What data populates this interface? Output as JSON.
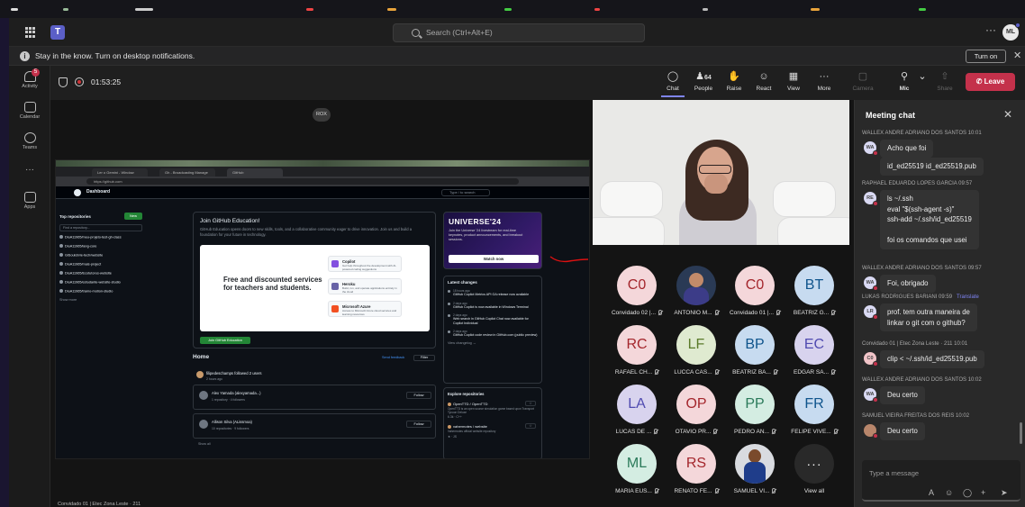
{
  "teams_header": {
    "search_placeholder": "Search (Ctrl+Alt+E)",
    "more": "···",
    "me_initials": "ML"
  },
  "notification": {
    "text": "Stay in the know. Turn on desktop notifications.",
    "turn_on": "Turn on",
    "close": "✕"
  },
  "rail": {
    "activity": {
      "label": "Activity",
      "badge": "5"
    },
    "calendar": {
      "label": "Calendar"
    },
    "teams": {
      "label": "Teams"
    },
    "more": "···",
    "apps": {
      "label": "Apps"
    }
  },
  "meeting": {
    "timer": "01:53:25",
    "toolbar": {
      "chat": "Chat",
      "people": "People",
      "people_count": "64",
      "raise": "Raise",
      "react": "React",
      "view": "View",
      "more": "More",
      "camera": "Camera",
      "mic": "Mic",
      "share": "Share",
      "leave": "Leave"
    },
    "presenter_tag": "ROX",
    "bottom_label": "Convidado 01 | Etec Zona Leste · 211"
  },
  "shared_screen": {
    "tabs": [
      "Ler o Gemini - Window",
      "Gh - Broadcasting Manage",
      "GitHub"
    ],
    "url": "https://github.com",
    "header_title": "Dashboard",
    "search": "Type / to search",
    "sidebar": {
      "title": "Top repositories",
      "new": "New",
      "find": "Find a repository...",
      "repos": [
        "DiuA11965/meu-projeto-test-gh-class",
        "DiuA11965/lang-core",
        "GiSoulobrie-tech/website",
        "DiuA11965/mais-project",
        "DiuA11965/Ecotutores-website",
        "DiuA11965/estudante-website-studio",
        "DiuA11965/tramo-motion-studio"
      ],
      "show_more": "Show more"
    },
    "education": {
      "title": "Join GitHub Education!",
      "desc": "GitHub Education opens doors to new skills, tools, and a collaborative community eager to drive innovation. Join us and build a foundation for your future in technology.",
      "headline": "Free and discounted services for teachers and students.",
      "cards": [
        {
          "name": "Copilot",
          "desc": "Get help throughout the development with AI-powered coding suggestions"
        },
        {
          "name": "Heroku",
          "desc": "Build, run, and operate applications entirely in the cloud"
        },
        {
          "name": "Microsoft Azure",
          "desc": "Access to Microsoft Azure cloud services and learning resources"
        }
      ],
      "join": "Join GitHub Education"
    },
    "universe": {
      "title": "UNIVERSE'24",
      "desc": "Join the Universe '24 livestream for real-time keynotes, product announcements, and breakout sessions.",
      "button": "Watch now"
    },
    "changes": {
      "title": "Latest changes",
      "items": [
        {
          "when": "18 hours ago",
          "text": "GitHub Copilot Metrics API GA release now available"
        },
        {
          "when": "2 days ago",
          "text": "GitHub Copilot is now available in Windows Terminal"
        },
        {
          "when": "2 days ago",
          "text": "Web search in GitHub Copilot Chat now available for Copilot Individual"
        },
        {
          "when": "2 days ago",
          "text": "GitHub Copilot code review in GitHub.com (public preview)"
        }
      ],
      "view_all": "View changelog →"
    },
    "explore": {
      "title": "Explore repositories",
      "repos": [
        {
          "name": "OpenTTD / OpenTTD",
          "desc": "OpenTTD is an open source simulation game based upon Transport Tycoon Deluxe",
          "stats": "6.3k · C++"
        },
        {
          "name": "vahermotes / website",
          "desc": "Vahermotes official website repository",
          "stats": "★ · JS"
        }
      ]
    },
    "home": {
      "title": "Home",
      "send_feedback": "Send feedback",
      "filter": "Filter",
      "followed": {
        "who": "filipedeschamps followed 2 users",
        "when": "2 hours ago"
      },
      "cards": [
        {
          "name": "Alex Yamada (alexyamada...)",
          "stats": "1 repository · 4 followers",
          "follow": "Follow"
        },
        {
          "name": "Allison Silva (ALissmoa)",
          "stats": "10 repositories · 9 followers",
          "follow": "Follow"
        }
      ],
      "show_all": "Show all"
    }
  },
  "participants": [
    {
      "initials": "C0",
      "name": "Convidado 02 |...",
      "bg": "#f4d7da",
      "fg": "#a4262c"
    },
    {
      "initials": "",
      "name": "ANTONIO M...",
      "bg": "photo",
      "fg": ""
    },
    {
      "initials": "C0",
      "name": "Convidado 01 |...",
      "bg": "#f4d7da",
      "fg": "#a4262c"
    },
    {
      "initials": "BT",
      "name": "BEATRIZ G...",
      "bg": "#c7dbf0",
      "fg": "#0f548c"
    },
    {
      "initials": "RC",
      "name": "RAFAEL CH...",
      "bg": "#f4d7da",
      "fg": "#a4262c"
    },
    {
      "initials": "LF",
      "name": "LUCCA CAS...",
      "bg": "#dfead0",
      "fg": "#5a7a2a"
    },
    {
      "initials": "BP",
      "name": "BEATRIZ BA...",
      "bg": "#c7dbf0",
      "fg": "#0f548c"
    },
    {
      "initials": "EC",
      "name": "EDGAR SA...",
      "bg": "#d8d3ee",
      "fg": "#4f4ab0"
    },
    {
      "initials": "LA",
      "name": "LUCAS DE ...",
      "bg": "#d8d3ee",
      "fg": "#4f4ab0"
    },
    {
      "initials": "OP",
      "name": "OTAVIO PR...",
      "bg": "#f4d7da",
      "fg": "#a4262c"
    },
    {
      "initials": "PP",
      "name": "PEDRO AN...",
      "bg": "#d4ede2",
      "fg": "#2b7a5a"
    },
    {
      "initials": "FR",
      "name": "FELIPE VIVE...",
      "bg": "#c7dbf0",
      "fg": "#0f548c"
    },
    {
      "initials": "ML",
      "name": "MARIA EUS...",
      "bg": "#d4ede2",
      "fg": "#2b7a5a"
    },
    {
      "initials": "RS",
      "name": "RENATO FE...",
      "bg": "#f4d7da",
      "fg": "#a4262c"
    },
    {
      "initials": "",
      "name": "SAMUEL VI...",
      "bg": "photo2",
      "fg": ""
    },
    {
      "initials": "···",
      "name": "View all",
      "bg": "more",
      "fg": "#ffffff"
    }
  ],
  "chat": {
    "title": "Meeting chat",
    "close": "✕",
    "messages": [
      {
        "sender": "WALLEX ANDRE ADRIANO DOS SANTOS 10:01",
        "avatar": "WA",
        "lines": [
          "Acho que foi"
        ]
      },
      {
        "sender": "",
        "avatar": "",
        "lines": [
          "id_ed25519  id_ed25519.pub"
        ]
      },
      {
        "sender": "RAPHAEL EDUARDO LOPES GARCIA  09:57",
        "avatar": "RE",
        "lines": [
          "ls ~/.ssh",
          "eval \"$(ssh-agent -s)\"",
          "ssh-add ~/.ssh/id_ed25519",
          "",
          "foi os comandos que usei"
        ]
      },
      {
        "sender": "WALLEX ANDRE ADRIANO DOS SANTOS  09:57",
        "avatar": "WA",
        "lines": [
          "Foi, obrigado"
        ]
      },
      {
        "sender": "LUKAS RODRIGUES BARIANI  09:59",
        "translate": "Translate",
        "avatar": "LR",
        "lines": [
          "prof. tem outra maneira de",
          "linkar o git com o github?"
        ]
      },
      {
        "sender": "Convidado 01 | Etec Zona Leste · 211  10:01",
        "avatar": "C0",
        "lines": [
          "clip < ~/.ssh/id_ed25519.pub"
        ]
      },
      {
        "sender": "WALLEX ANDRE ADRIANO DOS SANTOS  10:02",
        "avatar": "WA",
        "lines": [
          "Deu certo"
        ]
      },
      {
        "sender": "SAMUEL VIEIRA FREITAS DOS REIS  10:02",
        "avatar": "",
        "lines": [
          "Deu certo"
        ]
      }
    ],
    "compose_placeholder": "Type a message"
  }
}
